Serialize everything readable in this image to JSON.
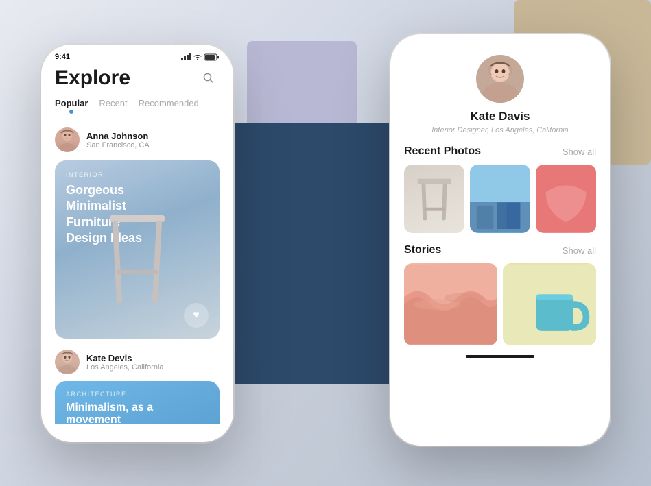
{
  "background": {
    "color": "#dde2eb"
  },
  "left_phone": {
    "status_bar": {
      "time": "9:41",
      "signal": "●●●",
      "wifi": "WiFi",
      "battery": "🔋"
    },
    "header": {
      "title": "Explore",
      "search_icon": "search"
    },
    "tabs": [
      {
        "label": "Popular",
        "active": true
      },
      {
        "label": "Recent",
        "active": false
      },
      {
        "label": "Recommended",
        "active": false
      }
    ],
    "first_post": {
      "user_name": "Anna Johnson",
      "user_location": "San Francisco, CA",
      "card_category": "INTERIOR",
      "card_title": "Gorgeous Minimalist Furniture Design Ideas",
      "heart_icon": "♥"
    },
    "second_post": {
      "user_name": "Kate Devis",
      "user_location": "Los Angeles, California",
      "card_category": "ARCHITECTURE",
      "card_title": "Minimalism, as a movement"
    }
  },
  "right_phone": {
    "profile": {
      "name": "Kate Davis",
      "bio": "Interior Designer, Los Angeles, California"
    },
    "recent_photos": {
      "section_title": "Recent Photos",
      "show_all_label": "Show all"
    },
    "stories": {
      "section_title": "Stories",
      "show_all_label": "Show all"
    }
  }
}
